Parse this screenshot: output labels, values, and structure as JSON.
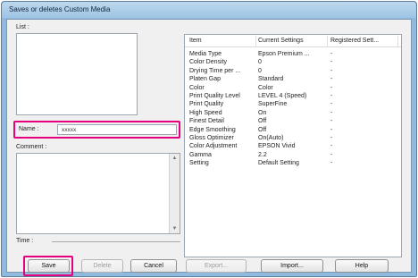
{
  "window": {
    "title": "Saves or deletes Custom Media"
  },
  "form": {
    "list_label": "List :",
    "name_label": "Name :",
    "name_value": "xxxxx",
    "comment_label": "Comment :",
    "time_label": "Time :"
  },
  "table": {
    "headers": [
      "Item",
      "Current Settings",
      "Registered Sett..."
    ],
    "rows": [
      {
        "item": "Media Type",
        "current": "Epson Premium ...",
        "registered": "-"
      },
      {
        "item": "Color Density",
        "current": "0",
        "registered": "-"
      },
      {
        "item": "Drying Time per ...",
        "current": "0",
        "registered": "-"
      },
      {
        "item": "Platen Gap",
        "current": "Standard",
        "registered": "-"
      },
      {
        "item": "Color",
        "current": "Color",
        "registered": "-"
      },
      {
        "item": "Print Quality Level",
        "current": "LEVEL 4 (Speed)",
        "registered": "-"
      },
      {
        "item": "Print Quality",
        "current": "SuperFine",
        "registered": "-"
      },
      {
        "item": "High Speed",
        "current": "On",
        "registered": "-"
      },
      {
        "item": "Finest Detail",
        "current": "Off",
        "registered": "-"
      },
      {
        "item": "Edge Smoothing",
        "current": "Off",
        "registered": "-"
      },
      {
        "item": "Gloss Optimizer",
        "current": "On(Auto)",
        "registered": "-"
      },
      {
        "item": "Color Adjustment",
        "current": "EPSON Vivid",
        "registered": "-"
      },
      {
        "item": "Gamma",
        "current": "2.2",
        "registered": "-"
      },
      {
        "item": "Setting",
        "current": "Default Setting",
        "registered": "-"
      }
    ]
  },
  "buttons": {
    "save": "Save",
    "delete": "Delete",
    "cancel": "Cancel",
    "export": "Export...",
    "import": "Import...",
    "help": "Help"
  },
  "colors": {
    "highlight": "#e6007e",
    "window_frame": "#8fb9dd",
    "dialog_bg": "#f0f0f0"
  }
}
